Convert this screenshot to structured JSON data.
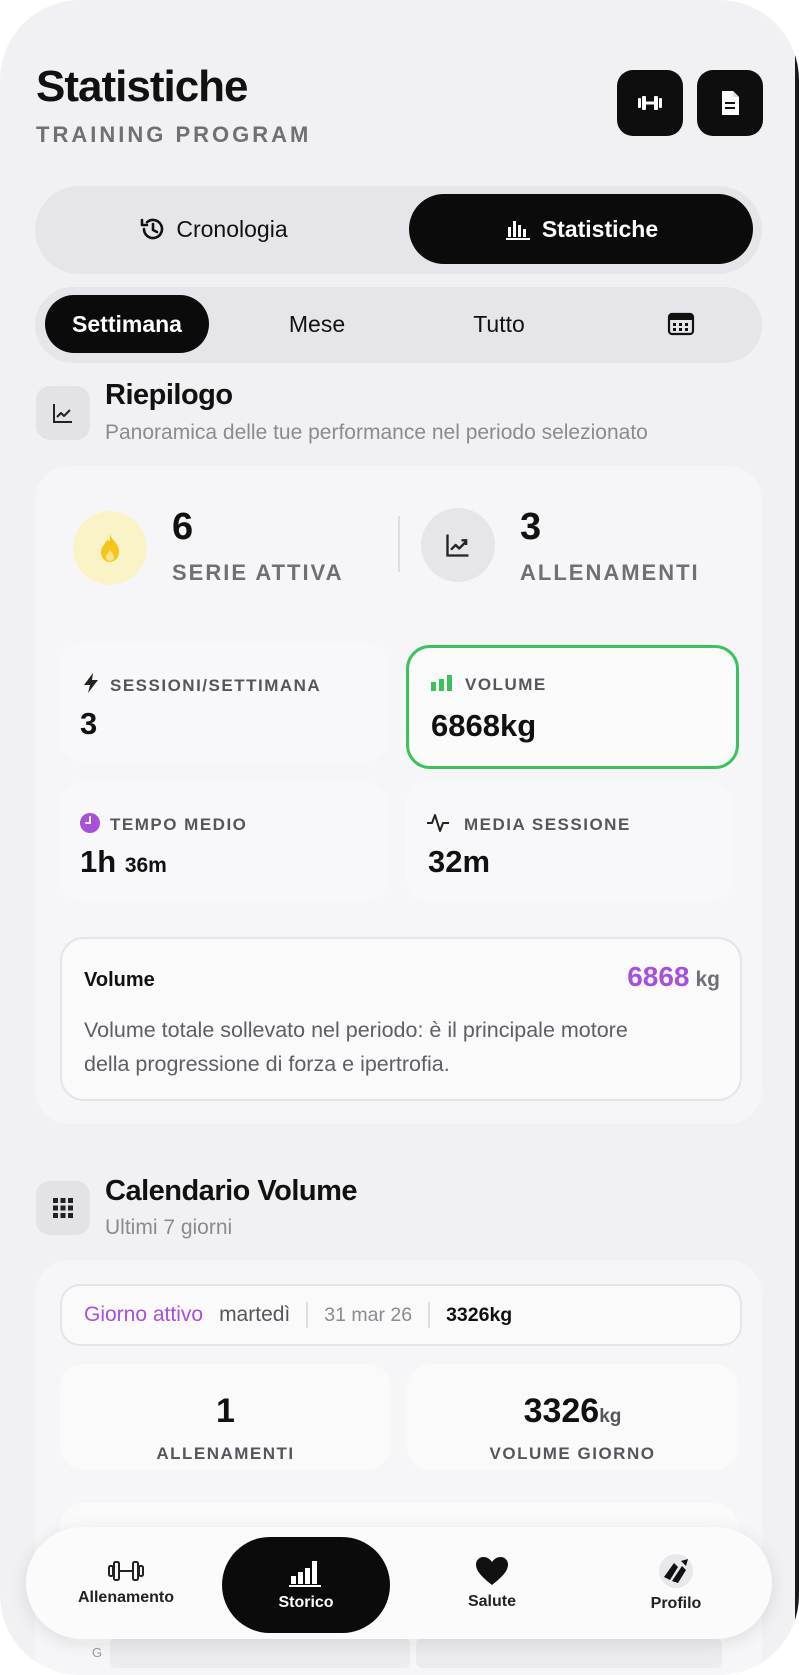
{
  "header": {
    "title": "Statistiche",
    "subtitle": "TRAINING PROGRAM",
    "icons": [
      "dumbbell-icon",
      "document-icon"
    ]
  },
  "view_tabs": [
    {
      "label": "Cronologia",
      "icon": "history-icon",
      "active": false
    },
    {
      "label": "Statistiche",
      "icon": "bar-chart-icon",
      "active": true
    }
  ],
  "period_tabs": [
    {
      "label": "Settimana",
      "active": true
    },
    {
      "label": "Mese",
      "active": false
    },
    {
      "label": "Tutto",
      "active": false
    },
    {
      "label": "",
      "icon": "calendar-icon",
      "active": false
    }
  ],
  "summary": {
    "title": "Riepilogo",
    "subtitle": "Panoramica delle tue performance nel periodo selezionato",
    "streak": {
      "value": "6",
      "label": "SERIE ATTIVA"
    },
    "workouts": {
      "value": "3",
      "label": "ALLENAMENTI"
    },
    "tiles": {
      "sessions": {
        "label": "SESSIONI/SETTIMANA",
        "value": "3"
      },
      "volume": {
        "label": "VOLUME",
        "value": "6868kg",
        "selected": true
      },
      "avg_time": {
        "label": "TEMPO MEDIO",
        "value_main": "1h",
        "value_small": "36m"
      },
      "avg_session": {
        "label": "MEDIA SESSIONE",
        "value": "32m"
      }
    },
    "detail": {
      "title": "Volume",
      "value": "6868",
      "unit": "kg",
      "description": "Volume totale sollevato nel periodo: è il principale motore della progressione di forza e ipertrofia."
    }
  },
  "calendar": {
    "title": "Calendario Volume",
    "subtitle": "Ultimi 7 giorni",
    "active_day": {
      "label": "Giorno attivo",
      "weekday": "martedì",
      "date": "31 mar 26",
      "volume": "3326kg"
    },
    "workouts": {
      "value": "1",
      "label": "ALLENAMENTI"
    },
    "day_volume": {
      "value": "3326",
      "unit": "kg",
      "label": "VOLUME GIORNO"
    },
    "row_letter": "G"
  },
  "colors": {
    "accent_purple": "#a94fd8",
    "accent_green": "#3cc25a",
    "dark": "#0b0b0b"
  },
  "tabbar": [
    {
      "label": "Allenamento",
      "icon": "dumbbell-icon",
      "active": false
    },
    {
      "label": "Storico",
      "icon": "bar-chart-icon",
      "active": true
    },
    {
      "label": "Salute",
      "icon": "heart-icon",
      "active": false
    },
    {
      "label": "Profilo",
      "icon": "profile-logo-icon",
      "active": false
    }
  ]
}
